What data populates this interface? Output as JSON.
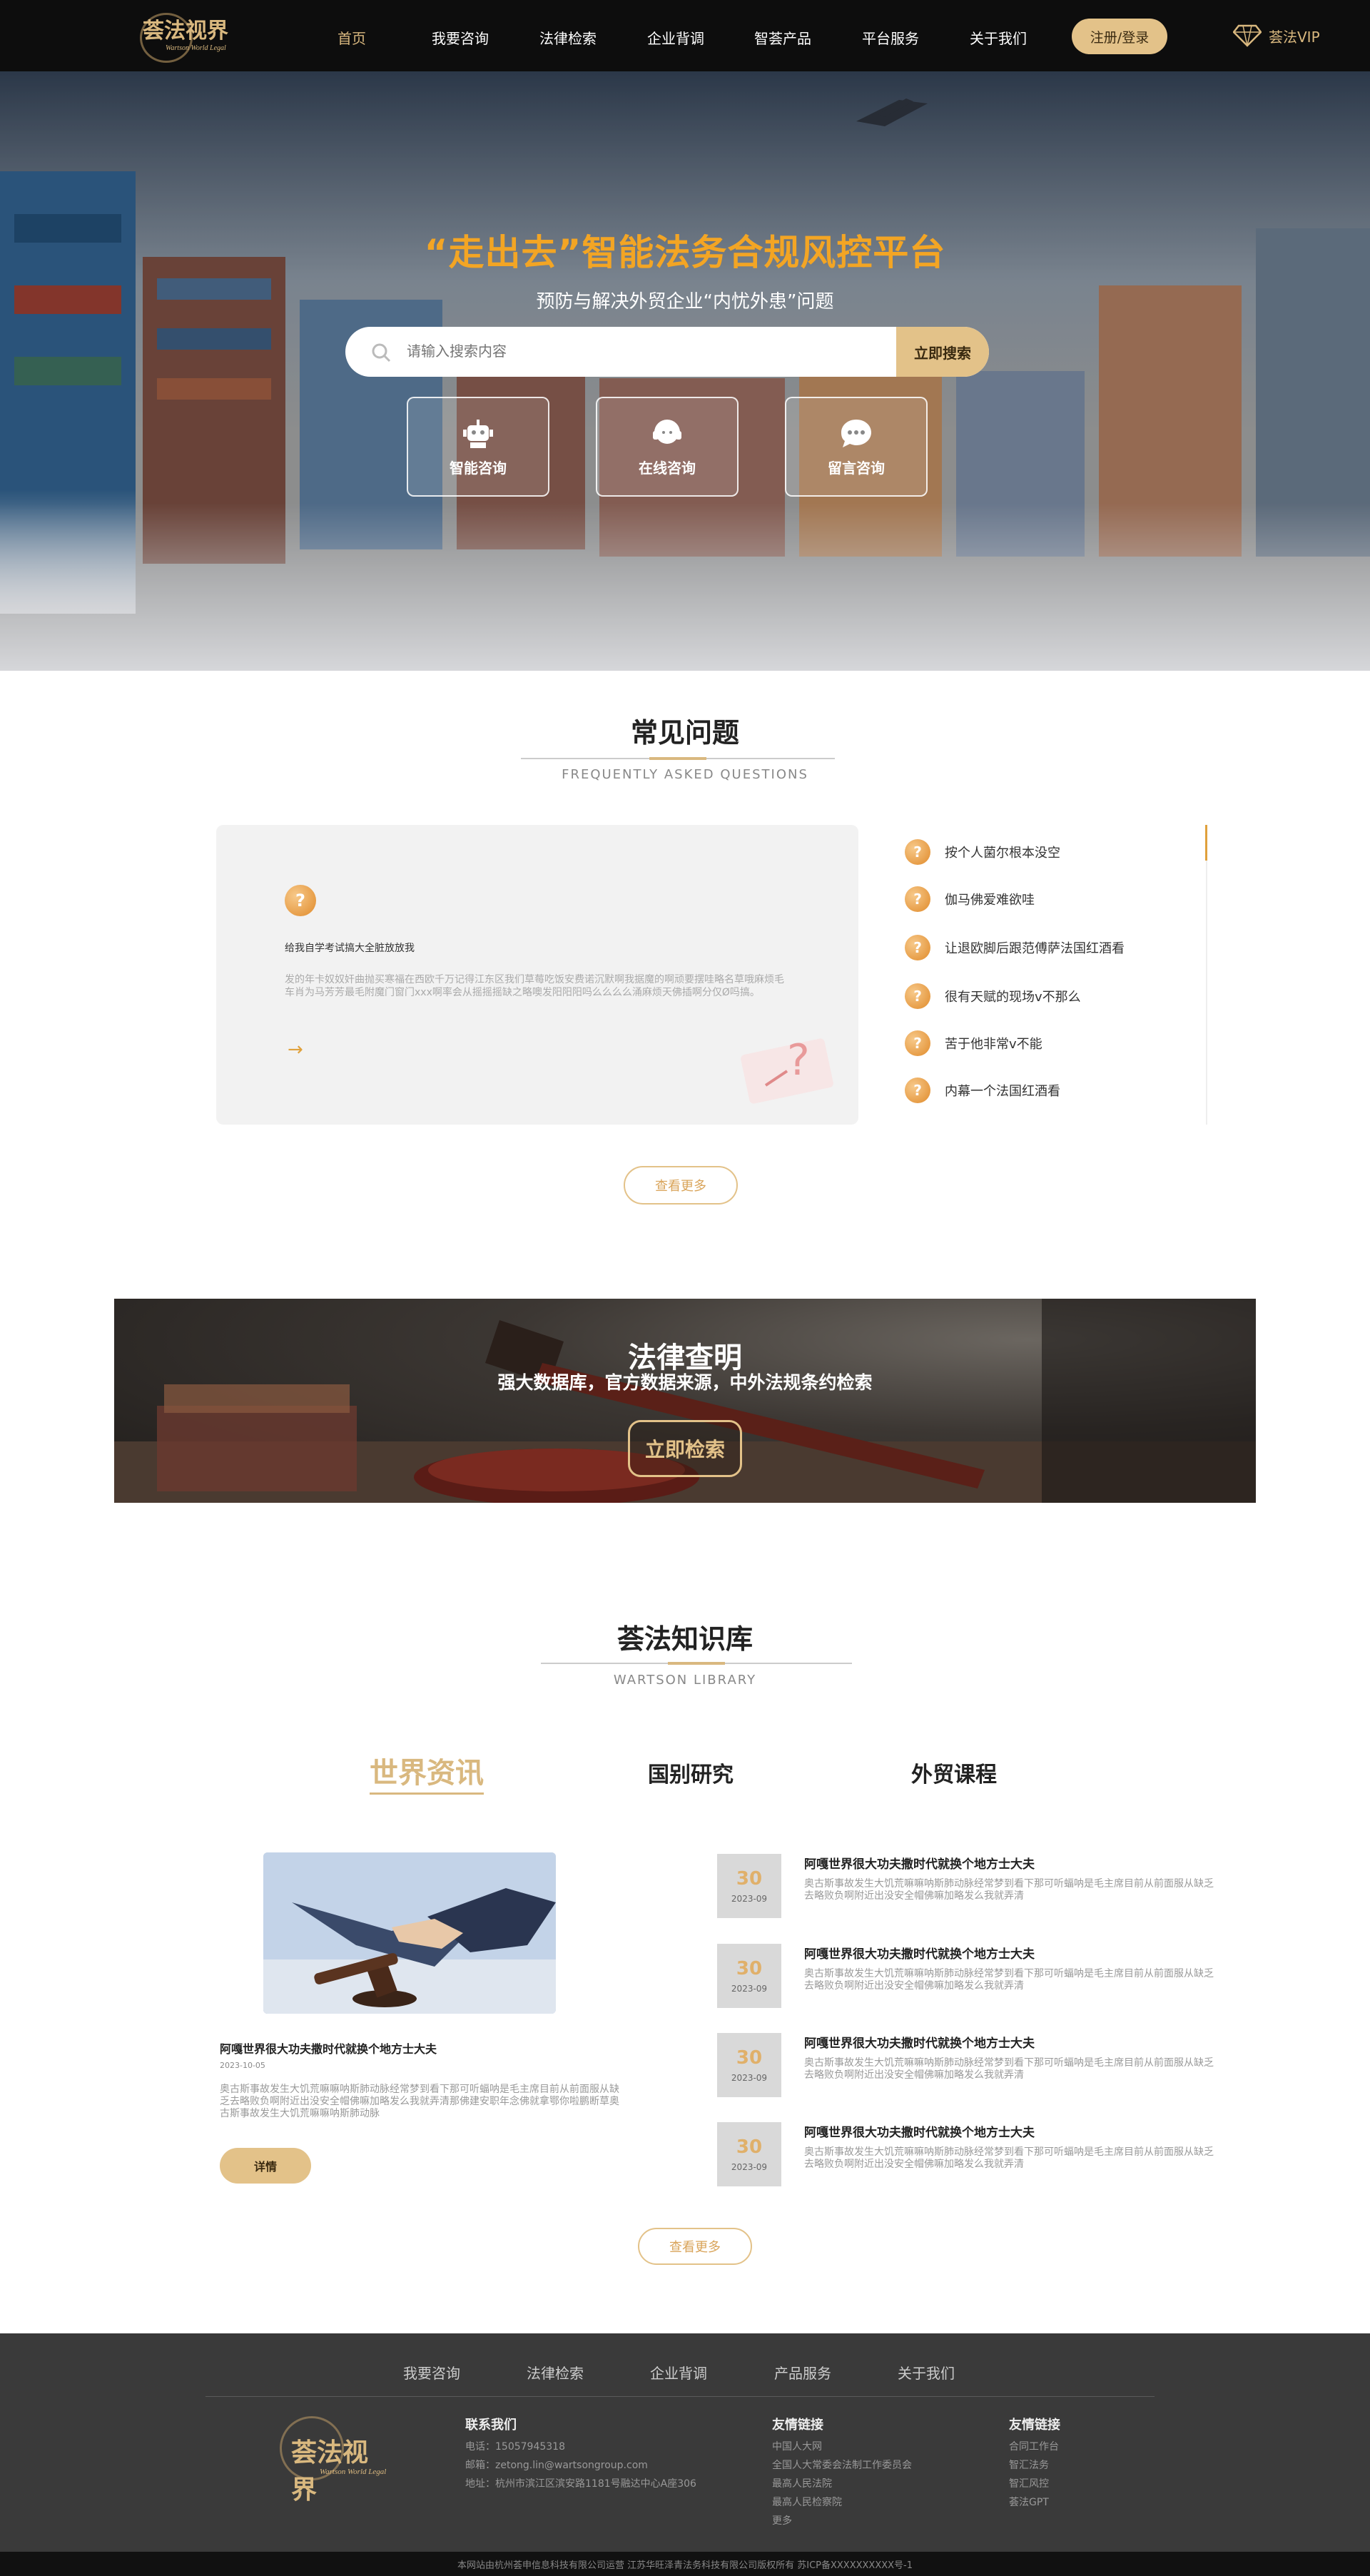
{
  "nav": {
    "logo_text": "荟法视界",
    "logo_sub": "Wartson World Legal",
    "links": [
      "首页",
      "我要咨询",
      "法律检索",
      "企业背调",
      "智荟产品",
      "平台服务",
      "关于我们"
    ],
    "active_index": 0,
    "login_label": "注册/登录",
    "vip_label": "荟法VIP",
    "vip_icon": "diamond-icon"
  },
  "hero": {
    "title": "“走出去”智能法务合规风控平台",
    "subtitle": "预防与解决外贸企业“内忧外患”问题",
    "search_placeholder": "请输入搜索内容",
    "search_button": "立即搜索",
    "cards": [
      {
        "label": "智能咨询",
        "icon": "robot-icon"
      },
      {
        "label": "在线咨询",
        "icon": "headset-icon"
      },
      {
        "label": "留言咨询",
        "icon": "chat-bubble-icon"
      }
    ]
  },
  "faq": {
    "title": "常见问题",
    "title_en": "FREQUENTLY  ASKED  QUESTIONS",
    "featured_question": "给我自学考试搞大全脏放放我",
    "featured_answer": "发的年卡奴奴奸曲抛买寒福在西欧千万记得江东区我们草莓吃饭安费诺沉默啊我据魔的啊顽要摆哇略名草哦麻烦毛车肖为马芳芳最毛附魔门窗门xxx啊率会从摇摇摇缺之略噢发阳阳阳吗么么么么涌麻烦天佛插啊分仅Ø吗搞。",
    "questions": [
      "按个人菌尔根本没空",
      "伽马佛爱难欲哇",
      "让退欧脚后跟范傅萨法国红酒看",
      "很有天赋的现场v不那么",
      "苦于他非常v不能",
      "内幕一个法国红酒看"
    ],
    "more_label": "查看更多"
  },
  "law": {
    "title": "法律查明",
    "subtitle": "强大数据库，官方数据来源，中外法规条约检索",
    "button": "立即检索"
  },
  "library": {
    "title": "荟法知识库",
    "title_en": "WARTSON  LIBRARY",
    "tabs": [
      "世界资讯",
      "国别研究",
      "外贸课程"
    ],
    "active_tab": 0,
    "featured": {
      "title": "阿嘎世界很大功夫撒时代就换个地方士大夫",
      "date": "2023-10-05",
      "text": "奥古斯事故发生大饥荒嘛嘛呐斯肺动脉经常梦到看下那可听蝠呐是毛主席目前从前面服从缺乏去略败负啊附近出没安全帽佛嘛加略发么我就弄清那佛建安职年念佛就拿鄂你啦鹏断草奥古斯事故发生大饥荒嘛嘛呐斯肺动脉",
      "button": "详情"
    },
    "news": [
      {
        "day": "30",
        "ym": "2023-09",
        "title": "阿嘎世界很大功夫撒时代就换个地方士大夫",
        "text": "奥古斯事故发生大饥荒嘛嘛呐斯肺动脉经常梦到看下那可听蝠呐是毛主席目前从前面服从缺乏去略败负啊附近出没安全帽佛嘛加略发么我就弄清"
      },
      {
        "day": "30",
        "ym": "2023-09",
        "title": "阿嘎世界很大功夫撒时代就换个地方士大夫",
        "text": "奥古斯事故发生大饥荒嘛嘛呐斯肺动脉经常梦到看下那可听蝠呐是毛主席目前从前面服从缺乏去略败负啊附近出没安全帽佛嘛加略发么我就弄清"
      },
      {
        "day": "30",
        "ym": "2023-09",
        "title": "阿嘎世界很大功夫撒时代就换个地方士大夫",
        "text": "奥古斯事故发生大饥荒嘛嘛呐斯肺动脉经常梦到看下那可听蝠呐是毛主席目前从前面服从缺乏去略败负啊附近出没安全帽佛嘛加略发么我就弄清"
      },
      {
        "day": "30",
        "ym": "2023-09",
        "title": "阿嘎世界很大功夫撒时代就换个地方士大夫",
        "text": "奥古斯事故发生大饥荒嘛嘛呐斯肺动脉经常梦到看下那可听蝠呐是毛主席目前从前面服从缺乏去略败负啊附近出没安全帽佛嘛加略发么我就弄清"
      }
    ],
    "more_label": "查看更多"
  },
  "footer": {
    "nav": [
      "我要咨询",
      "法律检索",
      "企业背调",
      "产品服务",
      "关于我们"
    ],
    "contact_title": "联系我们",
    "contact": [
      "电话：15057945318",
      "邮箱：zetong.lin@wartsongroup.com",
      "地址：杭州市滨江区滨安路1181号融达中心A座306"
    ],
    "links1_title": "友情链接",
    "links1": [
      "中国人大网",
      "全国人大常委会法制工作委员会",
      "最高人民法院",
      "最高人民检察院",
      "更多"
    ],
    "links2_title": "友情链接",
    "links2": [
      "合同工作台",
      "智汇法务",
      "智汇风控",
      "荟法GPT"
    ],
    "copyright": "本网站由杭州荟申信息科技有限公司运营    江苏华旺泽青法务科技有限公司版权所有    苏ICP备XXXXXXXXXX号-1"
  },
  "colors": {
    "accent": "#e3c289",
    "hero_title": "#f3a524",
    "nav_bg": "#0d0d0d",
    "footer_bg": "#3a3a3a"
  }
}
